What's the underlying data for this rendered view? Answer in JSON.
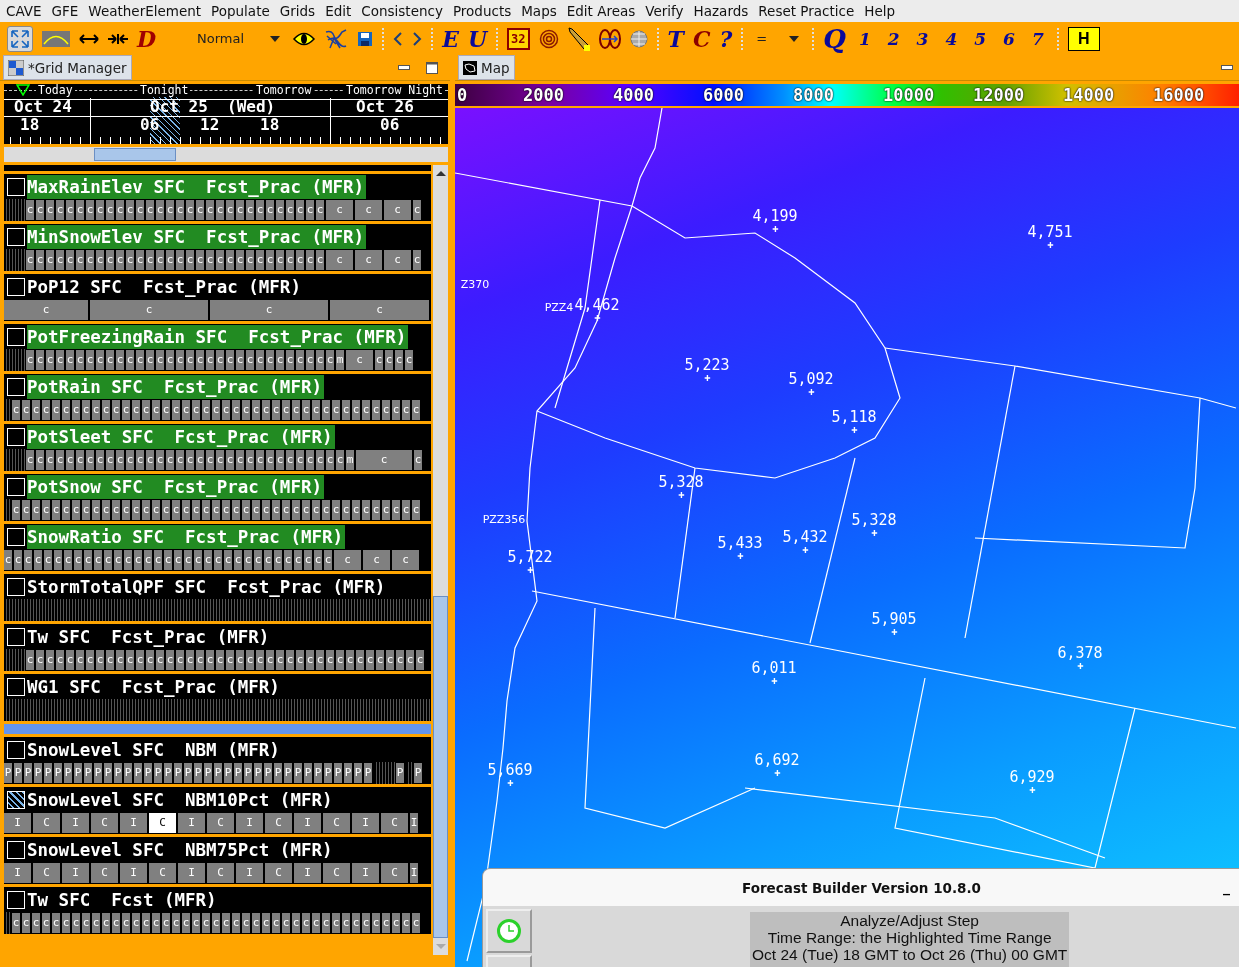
{
  "menu": [
    "CAVE",
    "GFE",
    "WeatherElement",
    "Populate",
    "Grids",
    "Edit",
    "Consistency",
    "Products",
    "Maps",
    "Edit Areas",
    "Verify",
    "Hazards",
    "Reset Practice",
    "Help"
  ],
  "toolbar": {
    "d_tool": "D",
    "mode": "Normal",
    "edit_tools": [
      "E",
      "U"
    ],
    "selector": "32",
    "tc_tools": [
      {
        "label": "T",
        "color": "#0a0a9a"
      },
      {
        "label": "C",
        "color": "#8b0000"
      },
      {
        "label": "?",
        "color": "#0a0a9a"
      }
    ],
    "operator": "=",
    "q_tool": "Q",
    "numbers": [
      "1",
      "2",
      "3",
      "4",
      "5",
      "6",
      "7"
    ],
    "hazard": "H"
  },
  "grid_manager": {
    "tab_title": "*Grid Manager",
    "periods": [
      "Today",
      "Tonight",
      "Tomorrow",
      "Tomorrow Night"
    ],
    "dates": [
      "Oct 24",
      "Oct 25  (Wed)",
      "Oct 26"
    ],
    "hours": [
      "18",
      "06",
      "12",
      "18",
      "06"
    ],
    "groups": [
      {
        "rows": [
          {
            "name": "MaxRainElev SFC  Fcst_Prac (MFR)",
            "checked": false,
            "highlighted": true,
            "segments": [
              {
                "kind": "nodata_short"
              },
              {
                "kind": "hourly",
                "letters": "c c c c c c c c c c c c c c c c c c c c c c c c c c c c c c"
              },
              {
                "kind": "block3",
                "letters": "c c c"
              },
              {
                "kind": "hourly",
                "letters": "c"
              }
            ]
          },
          {
            "name": "MinSnowElev SFC  Fcst_Prac (MFR)",
            "checked": false,
            "highlighted": true,
            "segments": [
              {
                "kind": "nodata_short"
              },
              {
                "kind": "hourly",
                "letters": "c c c c c c c c c c c c c c c c c c c c c c c c c c c c c c"
              },
              {
                "kind": "block3",
                "letters": "c c c"
              },
              {
                "kind": "hourly",
                "letters": "c"
              }
            ]
          },
          {
            "name": "PoP12 SFC  Fcst_Prac (MFR)",
            "checked": false,
            "highlighted": false,
            "segments": [
              {
                "kind": "block12_start",
                "letters": "c"
              },
              {
                "kind": "block12",
                "letters": "c c"
              },
              {
                "kind": "block12_end",
                "letters": "c"
              }
            ]
          },
          {
            "name": "PotFreezingRain SFC  Fcst_Prac (MFR)",
            "checked": false,
            "highlighted": true,
            "segments": [
              {
                "kind": "nodata_short"
              },
              {
                "kind": "hourly",
                "letters": "c c c c c c c c c c c c c c c c c c c c c c c c c c c c c c c m"
              },
              {
                "kind": "block3",
                "letters": "c"
              },
              {
                "kind": "hourly",
                "letters": "c c c c"
              }
            ]
          },
          {
            "name": "PotRain SFC  Fcst_Prac (MFR)",
            "checked": false,
            "highlighted": true,
            "segments": [
              {
                "kind": "nodata_tiny"
              },
              {
                "kind": "hourly",
                "letters": "c c c c c c c c c c c c c c c c c c c c c c c c c c c c c c c c c c c c c c c c c"
              }
            ]
          },
          {
            "name": "PotSleet SFC  Fcst_Prac (MFR)",
            "checked": false,
            "highlighted": true,
            "segments": [
              {
                "kind": "nodata_short"
              },
              {
                "kind": "hourly",
                "letters": "c c c c c c c c c c c c c c c c c c c c c c c c c c c c c c c c m"
              },
              {
                "kind": "block6",
                "letters": "c"
              },
              {
                "kind": "hourly",
                "letters": "c"
              }
            ]
          },
          {
            "name": "PotSnow SFC  Fcst_Prac (MFR)",
            "checked": false,
            "highlighted": true,
            "segments": [
              {
                "kind": "nodata_tiny"
              },
              {
                "kind": "hourly",
                "letters": "c c c c c c c c c c c c c c c c c c c c c c c c c c c c c c c c c c c c c c c c c"
              }
            ]
          },
          {
            "name": "SnowRatio SFC  Fcst_Prac (MFR)",
            "checked": false,
            "highlighted": true,
            "segments": [
              {
                "kind": "hourly",
                "letters": "c c c c c c c c c c c c c c c c c c c c c c c c c c c c c c c c c"
              },
              {
                "kind": "block3",
                "letters": "c c c"
              }
            ]
          },
          {
            "name": "StormTotalQPF SFC  Fcst_Prac (MFR)",
            "checked": false,
            "highlighted": false,
            "segments": [
              {
                "kind": "nodata_rest"
              }
            ]
          },
          {
            "name": "Tw SFC  Fcst_Prac (MFR)",
            "checked": false,
            "highlighted": false,
            "segments": [
              {
                "kind": "nodata_short"
              },
              {
                "kind": "hourly",
                "letters": "c c c c c c c c c c c c c c c c c c c c c c c c c c c c c c c c c c c c c c c c"
              }
            ]
          },
          {
            "name": "WG1 SFC  Fcst_Prac (MFR)",
            "checked": false,
            "highlighted": false,
            "segments": [
              {
                "kind": "nodata_rest"
              }
            ]
          }
        ]
      },
      {
        "rows": [
          {
            "name": "SnowLevel SFC  NBM (MFR)",
            "checked": false,
            "highlighted": false,
            "segments": [
              {
                "kind": "hourly",
                "letters": "P P P P P P P P P P P P P P P P P P P P P P P P P P P P P P P P P P P P P"
              },
              {
                "kind": "nodata_short"
              },
              {
                "kind": "hourly",
                "letters": "P"
              },
              {
                "kind": "nodata_tiny"
              },
              {
                "kind": "hourly",
                "letters": "P"
              }
            ]
          },
          {
            "name": "SnowLevel SFC  NBM10Pct (MFR)",
            "checked": true,
            "highlighted": false,
            "segments": [
              {
                "kind": "block3",
                "letters": "I C I C I"
              },
              {
                "kind": "block3_selected",
                "letters": "C"
              },
              {
                "kind": "block3",
                "letters": "I C I C I C I C"
              },
              {
                "kind": "hourly",
                "letters": "I"
              }
            ]
          },
          {
            "name": "SnowLevel SFC  NBM75Pct (MFR)",
            "checked": false,
            "highlighted": false,
            "segments": [
              {
                "kind": "block3",
                "letters": "I C I C I C I C I C I C I C"
              },
              {
                "kind": "hourly",
                "letters": "I"
              }
            ]
          },
          {
            "name": "Tw SFC  Fcst (MFR)",
            "checked": false,
            "highlighted": false,
            "segments": [
              {
                "kind": "nodata_tiny"
              },
              {
                "kind": "hourly",
                "letters": "c c c c c c c c c c c c c c c c c c c c c c c c c c c c c c c c c c c c c c c c c"
              }
            ]
          }
        ]
      }
    ]
  },
  "map": {
    "tab_title": "Map",
    "colorbar": [
      "0",
      "2000",
      "4000",
      "6000",
      "8000",
      "10000",
      "12000",
      "14000",
      "16000"
    ],
    "values": [
      "4,199",
      "4,751",
      "4,462",
      "5,223",
      "5,092",
      "5,118",
      "5,328",
      "5,433",
      "5,432",
      "5,328",
      "5,722",
      "5,905",
      "6,011",
      "6,378",
      "5,669",
      "6,692",
      "6,929"
    ],
    "zones": [
      "Z370",
      "PZZ4",
      "PZZ356"
    ]
  },
  "dialog": {
    "title": "Forecast Builder Version 10.8.0",
    "minimize": "_",
    "status": [
      "Analyze/Adjust Step",
      "Time Range:  the Highlighted Time Range",
      "Oct 24 (Tue) 18 GMT to Oct 26 (Thu) 00 GMT"
    ]
  }
}
